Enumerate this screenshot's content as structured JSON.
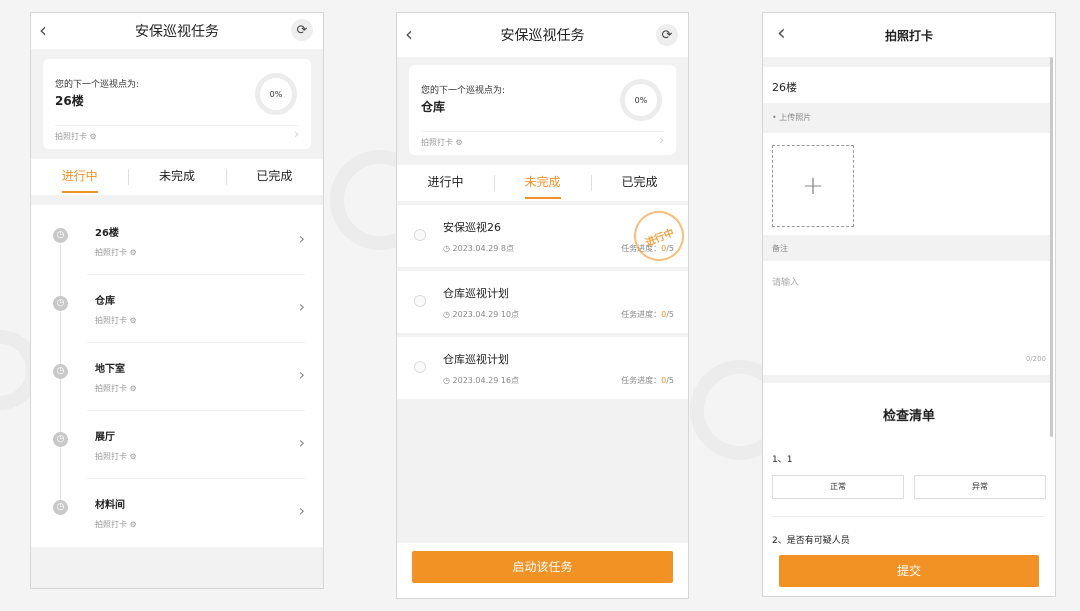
{
  "screen1": {
    "title": "安保巡视任务",
    "back_icon": "‹",
    "refresh_icon": "⟳",
    "card": {
      "label": "您的下一个巡视点为:",
      "location": "26楼",
      "progress": "0%",
      "checkin": "拍照打卡 ⚙"
    },
    "tabs": [
      {
        "label": "进行中",
        "active": true
      },
      {
        "label": "未完成",
        "active": false
      },
      {
        "label": "已完成",
        "active": false
      }
    ],
    "points": [
      {
        "name": "26楼",
        "sub": "拍照打卡 ⚙"
      },
      {
        "name": "仓库",
        "sub": "拍照打卡 ⚙"
      },
      {
        "name": "地下室",
        "sub": "拍照打卡 ⚙"
      },
      {
        "name": "展厅",
        "sub": "拍照打卡 ⚙"
      },
      {
        "name": "材料间",
        "sub": "拍照打卡 ⚙"
      }
    ]
  },
  "screen2": {
    "title": "安保巡视任务",
    "back_icon": "‹",
    "refresh_icon": "⟳",
    "card": {
      "label": "您的下一个巡视点为:",
      "location": "仓库",
      "progress": "0%",
      "checkin": "拍照打卡 ⚙"
    },
    "tabs": [
      {
        "label": "进行中",
        "active": false
      },
      {
        "label": "未完成",
        "active": true
      },
      {
        "label": "已完成",
        "active": false
      }
    ],
    "tasks": [
      {
        "name": "安保巡视26",
        "date": "◷ 2023.04.29 8点",
        "progress_label": "任务进度：",
        "done": "0",
        "total": "/5",
        "stamp": "进行中"
      },
      {
        "name": "仓库巡视计划",
        "date": "◷ 2023.04.29 10点",
        "progress_label": "任务进度：",
        "done": "0",
        "total": "/5"
      },
      {
        "name": "仓库巡视计划",
        "date": "◷ 2023.04.29 16点",
        "progress_label": "任务进度：",
        "done": "0",
        "total": "/5"
      }
    ],
    "start_button": "启动该任务"
  },
  "screen3": {
    "title": "拍照打卡",
    "back_icon": "‹",
    "location": "26楼",
    "upload_label": "• 上传照片",
    "upload_plus": "+",
    "remark_label": "备注",
    "remark_placeholder": "请输入",
    "remark_counter": "0/200",
    "checklist_title": "检查清单",
    "q1": "1、1",
    "q1_options": [
      "正常",
      "异常"
    ],
    "q2": "2、是否有可疑人员",
    "submit": "提交"
  },
  "colors": {
    "accent": "#f39224",
    "background": "#f2f2f2"
  }
}
